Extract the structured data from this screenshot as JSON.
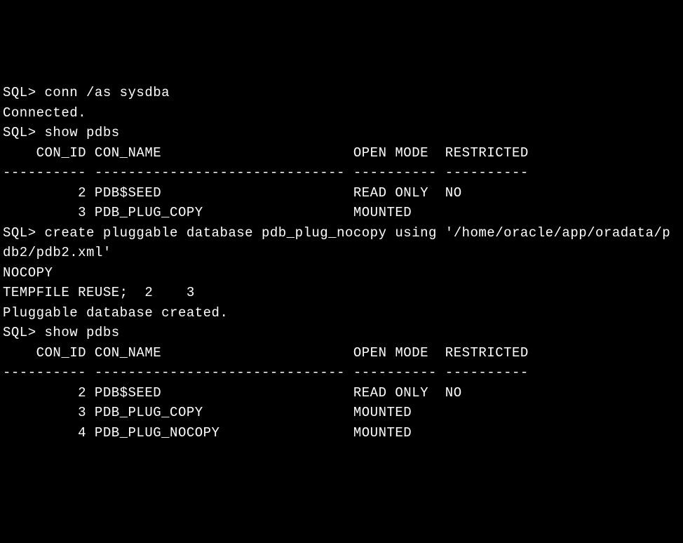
{
  "lines": {
    "l1": "SQL> conn /as sysdba",
    "l2": "Connected.",
    "l3": "SQL> show pdbs",
    "l4": "",
    "l5": "    CON_ID CON_NAME                       OPEN MODE  RESTRICTED",
    "l6": "---------- ------------------------------ ---------- ----------",
    "l7": "         2 PDB$SEED                       READ ONLY  NO",
    "l8": "         3 PDB_PLUG_COPY                  MOUNTED",
    "l9": "SQL> create pluggable database pdb_plug_nocopy using '/home/oracle/app/oradata/p",
    "l10": "db2/pdb2.xml'",
    "l11": "NOCOPY",
    "l12": "TEMPFILE REUSE;  2    3",
    "l13": "",
    "l14": "Pluggable database created.",
    "l15": "",
    "l16": "SQL> show pdbs",
    "l17": "",
    "l18": "    CON_ID CON_NAME                       OPEN MODE  RESTRICTED",
    "l19": "---------- ------------------------------ ---------- ----------",
    "l20": "         2 PDB$SEED                       READ ONLY  NO",
    "l21": "         3 PDB_PLUG_COPY                  MOUNTED",
    "l22": "         4 PDB_PLUG_NOCOPY                MOUNTED"
  }
}
